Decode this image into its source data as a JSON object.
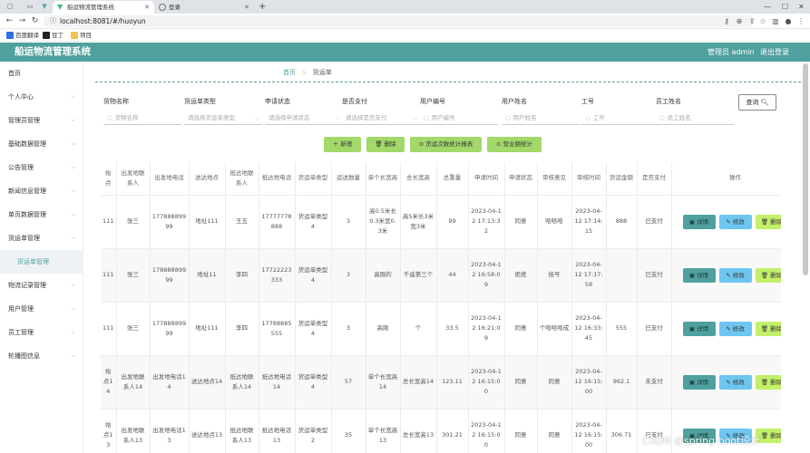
{
  "browser": {
    "tabs": [
      {
        "title": "船运物流管理系统",
        "active": true
      },
      {
        "title": "登录",
        "active": false
      }
    ],
    "url": "localhost:8081/#/huoyun",
    "bookmarks": [
      "百度翻译",
      "豆丁",
      "项目"
    ]
  },
  "header": {
    "title": "船运物流管理系统",
    "admin": "管理员 admin",
    "logout": "退出登录"
  },
  "sidebar": {
    "items": [
      {
        "label": "首页",
        "chevron": false
      },
      {
        "label": "个人中心",
        "chevron": true
      },
      {
        "label": "管理员管理",
        "chevron": true
      },
      {
        "label": "基础数据管理",
        "chevron": true
      },
      {
        "label": "公告管理",
        "chevron": true
      },
      {
        "label": "新闻信息管理",
        "chevron": true
      },
      {
        "label": "单页数据管理",
        "chevron": true
      },
      {
        "label": "货运单管理",
        "chevron": true
      },
      {
        "label": "货运单管理",
        "chevron": false,
        "sub": true
      },
      {
        "label": "物流记录管理",
        "chevron": true
      },
      {
        "label": "用户管理",
        "chevron": true
      },
      {
        "label": "员工管理",
        "chevron": true
      },
      {
        "label": "轮播图信息",
        "chevron": true
      }
    ]
  },
  "breadcrumb": {
    "home": "首页",
    "current": "货运单"
  },
  "filters": [
    {
      "label": "货物名称",
      "placeholder": "货物名称",
      "type": "text"
    },
    {
      "label": "货运单类型",
      "placeholder": "请选择货运单类型",
      "type": "select"
    },
    {
      "label": "申请状态",
      "placeholder": "请选择申请状态",
      "type": "select"
    },
    {
      "label": "是否支付",
      "placeholder": "请选择是否支付",
      "type": "select"
    },
    {
      "label": "用户编号",
      "placeholder": "用户编号",
      "type": "text"
    },
    {
      "label": "用户姓名",
      "placeholder": "用户姓名",
      "type": "text"
    },
    {
      "label": "工号",
      "placeholder": "工号",
      "type": "text"
    },
    {
      "label": "员工姓名",
      "placeholder": "员工姓名",
      "type": "text"
    }
  ],
  "query_button": "查询",
  "actions": [
    {
      "label": "＋ 新增"
    },
    {
      "label": "删除"
    },
    {
      "label": "货运次数统计报表"
    },
    {
      "label": "营业额统计"
    }
  ],
  "table": {
    "headers": [
      "始点",
      "出发地联系人",
      "出发地电话",
      "送达地点",
      "抵达地联系人",
      "抵达地电话",
      "货运单类型",
      "运送数量",
      "单个长宽高",
      "总长宽高",
      "总重量",
      "申请时间",
      "申请状态",
      "审核意见",
      "审核时间",
      "货运金额",
      "是否支付",
      "操作"
    ],
    "rows": [
      [
        "111",
        "张三",
        "17788889999",
        "地址111",
        "王五",
        "17777778888",
        "货运单类型4",
        "3",
        "高0.5米长0.3米宽0.3米",
        "高5米长3米宽3米",
        "99",
        "2023-04-12 17:13:32",
        "同意",
        "哈哈哈",
        "2023-04-12 17:14:15",
        "888",
        "已支付"
      ],
      [
        "111",
        "张三",
        "17888889999",
        "地址11",
        "李四",
        "17722223333",
        "货运单类型4",
        "3",
        "高刚的",
        "千遥第三个",
        "44",
        "2023-04-12 16:58:09",
        "拒绝",
        "挂号",
        "2023-04-12 17:17:58",
        "",
        "已支付"
      ],
      [
        "111",
        "张三",
        "17788889999",
        "地址111",
        "李四",
        "17788885555",
        "货运单类型4",
        "3",
        "高刚",
        "个",
        "33.5",
        "2023-04-12 16:21:09",
        "同意",
        "个哈哈哈成",
        "2023-04-12 16:33:45",
        "555",
        "已支付"
      ],
      [
        "始点14",
        "出发地联系人14",
        "出发地电话14",
        "送达地点14",
        "抵达地联系人14",
        "抵达地电话14",
        "货运单类型4",
        "57",
        "单个长宽高14",
        "总长宽高14",
        "123.11",
        "2023-04-12 16:15:00",
        "同意",
        "同意",
        "2023-04-12 16:15:00",
        "962.1",
        "未支付"
      ],
      [
        "始点13",
        "出发地联系人13",
        "出发地电话13",
        "送达地点13",
        "抵达地联系人13",
        "抵达地电话13",
        "货运单类型2",
        "35",
        "单个长宽高13",
        "总长宽高13",
        "301.21",
        "2023-04-12 16:15:00",
        "同意",
        "同意",
        "2023-04-12 16:15:00",
        "306.71",
        "已支付"
      ]
    ],
    "row_actions": {
      "detail": "详情",
      "edit": "修改",
      "delete": "删除"
    }
  },
  "watermark": "CSDN @spring boot设计",
  "colors": {
    "brand": "#4fa19e",
    "action_green": "#a3d86a",
    "edit_blue": "#6ec6f0",
    "delete_lime": "#c3f06a"
  }
}
